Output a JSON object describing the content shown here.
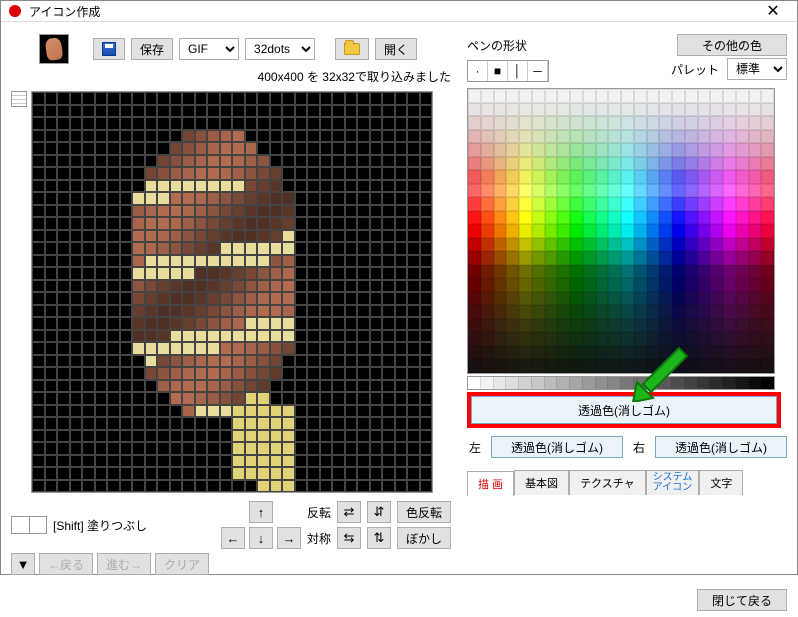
{
  "titlebar": {
    "title": "アイコン作成",
    "close": "✕"
  },
  "toolbar": {
    "save_label": "保存",
    "format_options": [
      "GIF"
    ],
    "format_selected": "GIF",
    "size_options": [
      "32dots"
    ],
    "size_selected": "32dots",
    "open_label": "開く"
  },
  "status": "400x400 を 32x32で取り込みました",
  "shift_hint": "[Shift] 塗りつぶし",
  "tools": {
    "flip_label": "反転",
    "sym_label": "対称",
    "color_invert": "色反転",
    "blur": "ぼかし",
    "back": "←戻る",
    "forward": "進む→",
    "clear": "クリア"
  },
  "right": {
    "pen_shape_label": "ペンの形状",
    "other_colors": "その他の色",
    "palette_label": "パレット",
    "palette_options": [
      "標準"
    ],
    "palette_selected": "標準"
  },
  "transparent_btn": "透過色(消しゴム)",
  "left_label": "左",
  "right_label": "右",
  "left_val": "透過色(消しゴム)",
  "right_val": "透過色(消しゴム)",
  "tabs": {
    "draw": "描 画",
    "basic": "基本図",
    "texture": "テクスチャ",
    "system": "システム\nアイコン",
    "text": "文字"
  },
  "footer_btn": "閉じて戻る",
  "chart_data": {
    "type": "pixel-editor",
    "grid": "32x32",
    "note": "pixel sprite of skewered food (corn dog/kebab) on black background"
  }
}
